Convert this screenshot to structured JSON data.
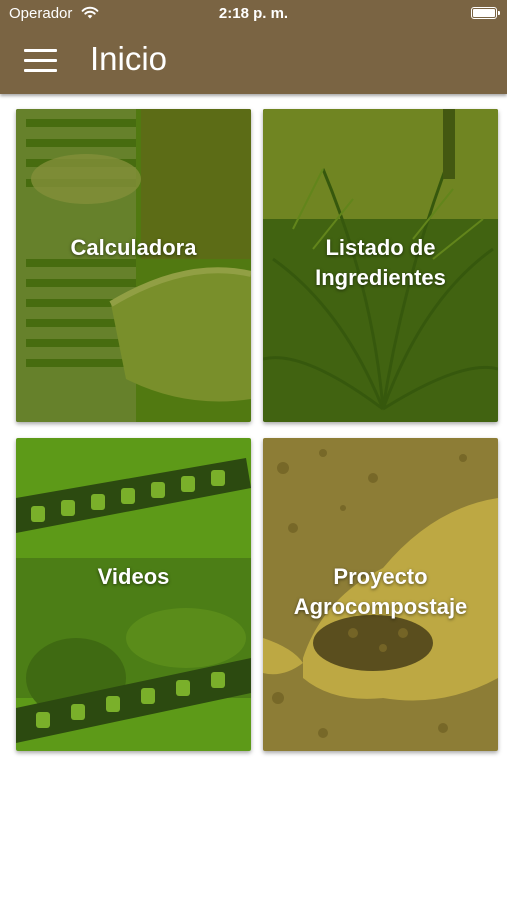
{
  "status_bar": {
    "carrier": "Operador",
    "time": "2:18 p. m."
  },
  "app_bar": {
    "title": "Inicio",
    "menu_icon": "hamburger-menu-icon",
    "color": "#7a6443"
  },
  "tiles": [
    {
      "line1": "Calculadora",
      "line2": ""
    },
    {
      "line1": "Listado de",
      "line2": "Ingredientes"
    },
    {
      "line1": "Videos",
      "line2": ""
    },
    {
      "line1": "Proyecto",
      "line2": "Agrocompostaje"
    }
  ],
  "colors": {
    "tile_tint_green": "#5a8f10",
    "tile_tint_olive": "#9a8c2a"
  }
}
